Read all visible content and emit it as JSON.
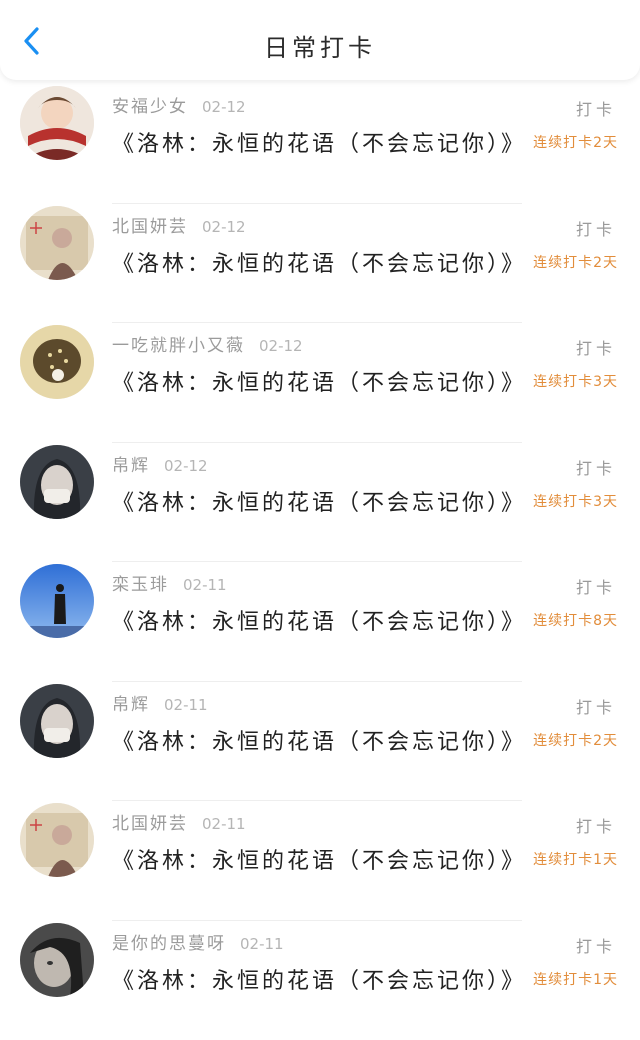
{
  "header": {
    "title": "日常打卡",
    "back_icon": "chevron-left-icon",
    "accent": "#1a8ff2"
  },
  "colors": {
    "name": "#9b9b9b",
    "streak": "#e28d3b",
    "book": "#222222"
  },
  "entries": [
    {
      "name": "安福少女",
      "date": "02-12",
      "book": "《洛林：永恒的花语（不会忘记你）》",
      "action": "打卡",
      "streak": "连续打卡2天",
      "avatar": "avatar-red-scarf"
    },
    {
      "name": "北国妍芸",
      "date": "02-12",
      "book": "《洛林：永恒的花语（不会忘记你）》",
      "action": "打卡",
      "streak": "连续打卡2天",
      "avatar": "avatar-vintage-girl"
    },
    {
      "name": "一吃就胖小又薇",
      "date": "02-12",
      "book": "《洛林：永恒的花语（不会忘记你）》",
      "action": "打卡",
      "streak": "连续打卡3天",
      "avatar": "avatar-strawberry"
    },
    {
      "name": "帛辉",
      "date": "02-12",
      "book": "《洛林：永恒的花语（不会忘记你）》",
      "action": "打卡",
      "streak": "连续打卡3天",
      "avatar": "avatar-masked-girl"
    },
    {
      "name": "栾玉琲",
      "date": "02-11",
      "book": "《洛林：永恒的花语（不会忘记你）》",
      "action": "打卡",
      "streak": "连续打卡8天",
      "avatar": "avatar-blue-sky"
    },
    {
      "name": "帛辉",
      "date": "02-11",
      "book": "《洛林：永恒的花语（不会忘记你）》",
      "action": "打卡",
      "streak": "连续打卡2天",
      "avatar": "avatar-masked-girl"
    },
    {
      "name": "北国妍芸",
      "date": "02-11",
      "book": "《洛林：永恒的花语（不会忘记你）》",
      "action": "打卡",
      "streak": "连续打卡1天",
      "avatar": "avatar-vintage-girl"
    },
    {
      "name": "是你的思蔓呀",
      "date": "02-11",
      "book": "《洛林：永恒的花语（不会忘记你）》",
      "action": "打卡",
      "streak": "连续打卡1天",
      "avatar": "avatar-dark-portrait"
    }
  ]
}
